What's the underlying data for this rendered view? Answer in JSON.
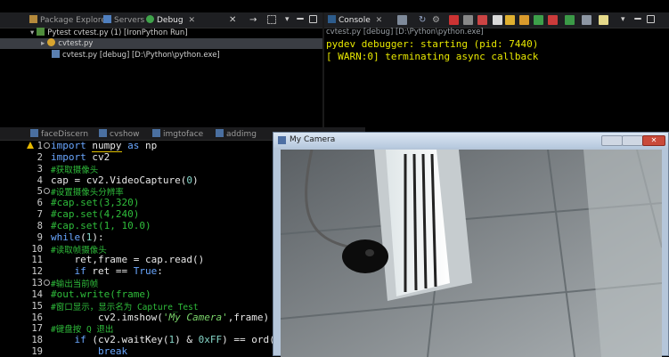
{
  "debug_view": {
    "tabs": [
      "Package Explorer",
      "Servers",
      "Debug"
    ],
    "tree": [
      "Pytest cvtest.py (1) [IronPython Run]",
      "cvtest.py",
      "cvtest.py [debug] [D:\\Python\\python.exe]"
    ]
  },
  "console_view": {
    "tab": "Console",
    "subtitle": "cvtest.py [debug] [D:\\Python\\python.exe]",
    "lines": [
      "pydev debugger: starting (pid: 7440)",
      "[ WARN:0] terminating async callback"
    ]
  },
  "editor": {
    "tabs": [
      "faceDiscern",
      "cvshow",
      "imgtoface",
      "addimg"
    ],
    "line_numbers": [
      "1",
      "2",
      "3",
      "4",
      "5",
      "6",
      "7",
      "8",
      "9",
      "10",
      "11",
      "12",
      "13",
      "14",
      "15",
      "16",
      "17",
      "18",
      "19"
    ]
  },
  "camera_window": {
    "title": "My Camera"
  },
  "colors": {
    "console_text": "#e8e800",
    "comment": "#2fbd3b",
    "keyword": "#6aa7ff",
    "selection": "#3a3d43"
  }
}
